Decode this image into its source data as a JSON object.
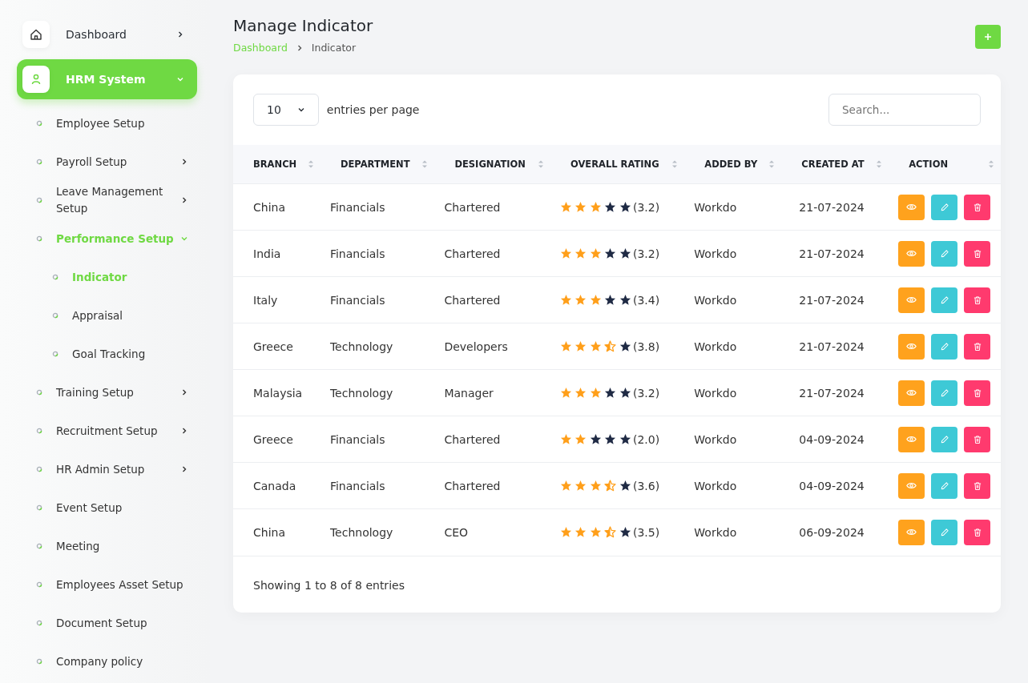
{
  "sidebar": {
    "items": [
      {
        "label": "Dashboard",
        "kind": "submenu",
        "expanded": false,
        "selected": false
      },
      {
        "label": "HRM System",
        "kind": "submenu",
        "expanded": true,
        "selected": true,
        "children": [
          {
            "label": "Employee Setup",
            "kind": "link",
            "selected": false
          },
          {
            "label": "Payroll Setup",
            "kind": "submenu",
            "expanded": false,
            "selected": false
          },
          {
            "label": "Leave Management Setup",
            "kind": "submenu",
            "expanded": false,
            "selected": false
          },
          {
            "label": "Performance Setup",
            "kind": "submenu",
            "expanded": true,
            "selected": true,
            "children": [
              {
                "label": "Indicator",
                "selected": true
              },
              {
                "label": "Appraisal",
                "selected": false
              },
              {
                "label": "Goal Tracking",
                "selected": false
              }
            ]
          },
          {
            "label": "Training Setup",
            "kind": "submenu",
            "expanded": false,
            "selected": false
          },
          {
            "label": "Recruitment Setup",
            "kind": "submenu",
            "expanded": false,
            "selected": false
          },
          {
            "label": "HR Admin Setup",
            "kind": "submenu",
            "expanded": false,
            "selected": false
          },
          {
            "label": "Event Setup",
            "kind": "link",
            "selected": false
          },
          {
            "label": "Meeting",
            "kind": "link",
            "selected": false
          },
          {
            "label": "Employees Asset Setup",
            "kind": "link",
            "selected": false
          },
          {
            "label": "Document Setup",
            "kind": "link",
            "selected": false
          },
          {
            "label": "Company policy",
            "kind": "link",
            "selected": false
          }
        ]
      }
    ]
  },
  "header": {
    "title": "Manage Indicator",
    "breadcrumb": [
      "Dashboard",
      "Indicator"
    ]
  },
  "table": {
    "page_size": "10",
    "page_size_label": "entries per page",
    "search": {
      "placeholder": "Search..."
    },
    "columns": [
      "BRANCH",
      "DEPARTMENT",
      "DESIGNATION",
      "OVERALL RATING",
      "ADDED BY",
      "CREATED AT",
      "ACTION"
    ],
    "rows": [
      {
        "branch": "China",
        "department": "Financials",
        "designation": "Chartered",
        "stars": 3,
        "rating": "(3.2)",
        "added_by": "Workdo",
        "created_at": "21-07-2024"
      },
      {
        "branch": "India",
        "department": "Financials",
        "designation": "Chartered",
        "stars": 3,
        "rating": "(3.2)",
        "added_by": "Workdo",
        "created_at": "21-07-2024"
      },
      {
        "branch": "Italy",
        "department": "Financials",
        "designation": "Chartered",
        "stars": 3,
        "rating": "(3.4)",
        "added_by": "Workdo",
        "created_at": "21-07-2024"
      },
      {
        "branch": "Greece",
        "department": "Technology",
        "designation": "Developers",
        "stars": 3.5,
        "rating": "(3.8)",
        "added_by": "Workdo",
        "created_at": "21-07-2024"
      },
      {
        "branch": "Malaysia",
        "department": "Technology",
        "designation": "Manager",
        "stars": 3,
        "rating": "(3.2)",
        "added_by": "Workdo",
        "created_at": "21-07-2024"
      },
      {
        "branch": "Greece",
        "department": "Financials",
        "designation": "Chartered",
        "stars": 2,
        "rating": "(2.0)",
        "added_by": "Workdo",
        "created_at": "04-09-2024"
      },
      {
        "branch": "Canada",
        "department": "Financials",
        "designation": "Chartered",
        "stars": 3.5,
        "rating": "(3.6)",
        "added_by": "Workdo",
        "created_at": "04-09-2024"
      },
      {
        "branch": "China",
        "department": "Technology",
        "designation": "CEO",
        "stars": 3.5,
        "rating": "(3.5)",
        "added_by": "Workdo",
        "created_at": "06-09-2024"
      }
    ],
    "footer": "Showing 1 to 8 of 8 entries"
  }
}
